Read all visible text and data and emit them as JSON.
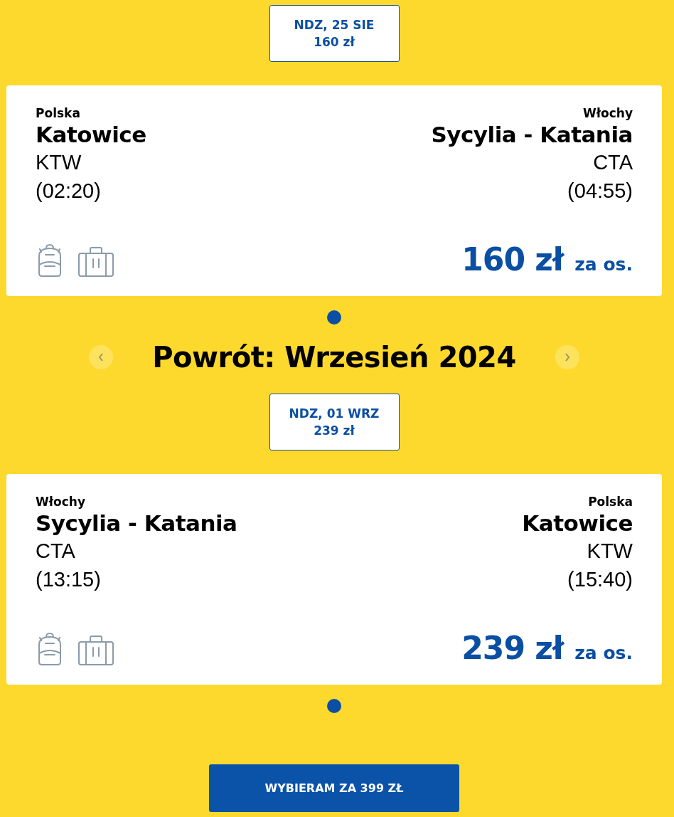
{
  "sections": [
    {
      "kind": "leg",
      "date_chip": {
        "day": "NDZ, 25 SIE",
        "price": "160 zł"
      },
      "from": {
        "country": "Polska",
        "city": "Katowice",
        "code": "KTW",
        "time": "(02:20)"
      },
      "to": {
        "country": "Włochy",
        "city": "Sycylia - Katania",
        "code": "CTA",
        "time": "(04:55)"
      },
      "price": "160 zł",
      "price_unit": "za os.",
      "pager": [
        {
          "selected": true
        }
      ]
    },
    {
      "kind": "month",
      "title": "Powrót: Wrzesień 2024",
      "prev_disabled": true,
      "next_disabled": true
    },
    {
      "kind": "leg",
      "date_chip": {
        "day": "NDZ, 01 WRZ",
        "price": "239 zł"
      },
      "from": {
        "country": "Włochy",
        "city": "Sycylia - Katania",
        "code": "CTA",
        "time": "(13:15)"
      },
      "to": {
        "country": "Polska",
        "city": "Katowice",
        "code": "KTW",
        "time": "(15:40)"
      },
      "price": "239 zł",
      "price_unit": "za os.",
      "pager": [
        {
          "selected": true
        }
      ]
    }
  ],
  "select_button": "WYBIERAM ZA 399 ZŁ"
}
